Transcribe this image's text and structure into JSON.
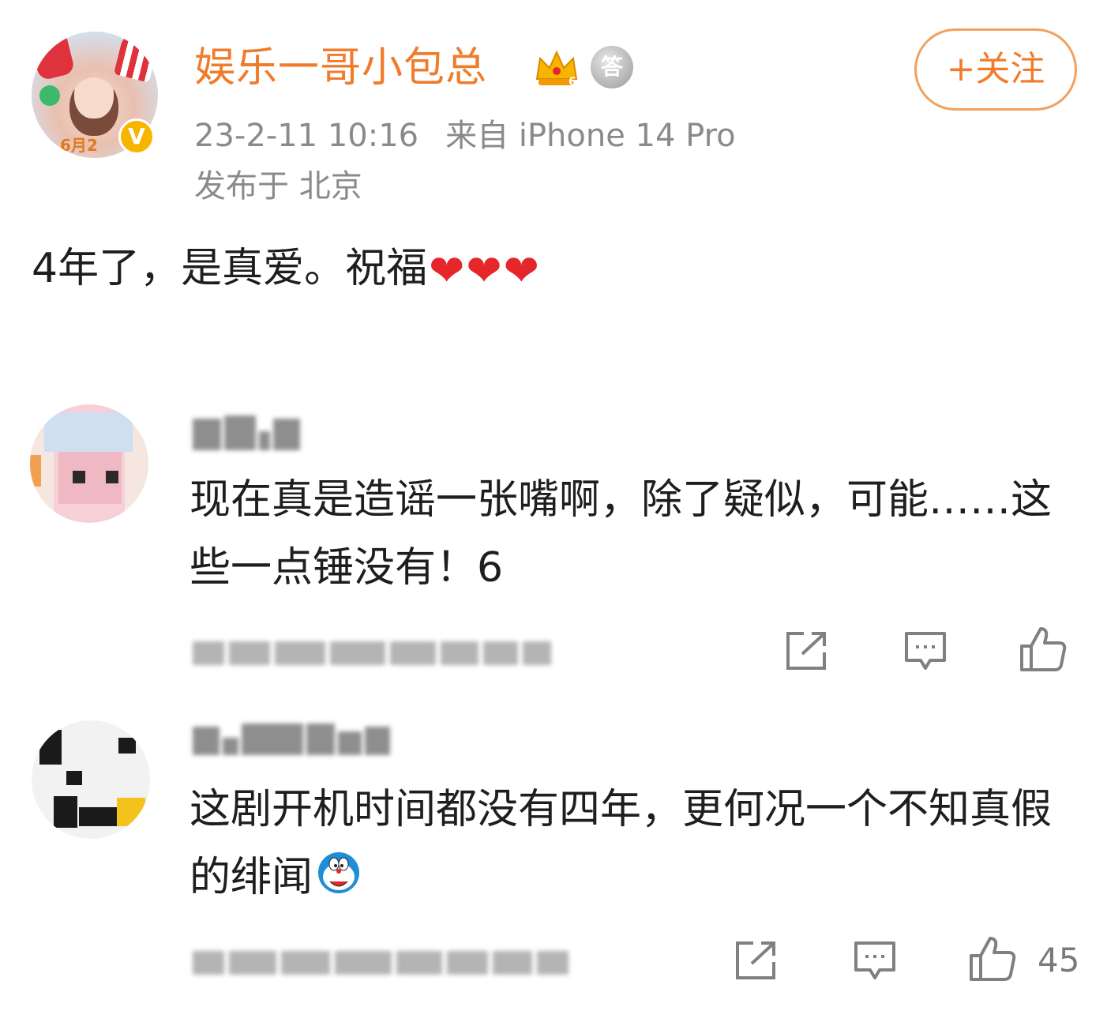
{
  "post": {
    "author_name": "娱乐一哥小包总",
    "badge_crown_level": "6",
    "badge_medal": "答",
    "avatar_date_tag": "6月2",
    "time": "23-2-11 10:16",
    "source": "来自 iPhone 14 Pro",
    "location": "发布于 北京",
    "follow_label": "+关注",
    "text": "4年了，是真爱。祝福"
  },
  "comments": [
    {
      "text": "现在真是造谣一张嘴啊，除了疑似，可能……这些一点锤没有！6",
      "like_count": ""
    },
    {
      "text": "这剧开机时间都没有四年，更何况一个不知真假的绯闻",
      "like_count": "45"
    }
  ],
  "colors": {
    "accent": "#f07c2b",
    "meta_gray": "#8a8a8a",
    "heart_red": "#e5262a"
  },
  "icons": [
    "crown-icon",
    "medal-icon",
    "verified-icon",
    "heart-icon",
    "share-icon",
    "comment-icon",
    "like-icon",
    "doraemon-emoji-icon"
  ]
}
